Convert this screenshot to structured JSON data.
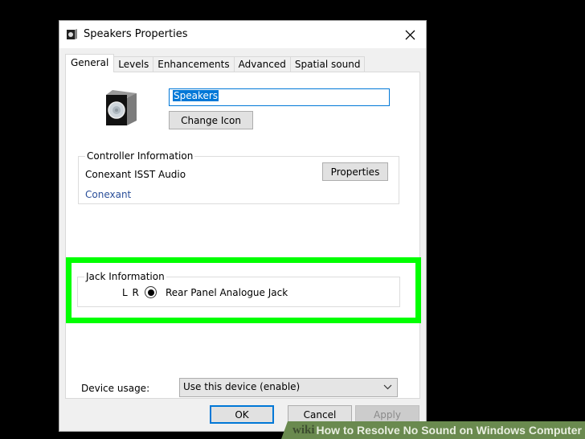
{
  "window": {
    "title": "Speakers Properties",
    "icon": "speaker-icon",
    "close_icon": "close-icon"
  },
  "tabs": [
    {
      "label": "General",
      "active": true
    },
    {
      "label": "Levels",
      "active": false
    },
    {
      "label": "Enhancements",
      "active": false
    },
    {
      "label": "Advanced",
      "active": false
    },
    {
      "label": "Spatial sound",
      "active": false
    }
  ],
  "general": {
    "device_name_value": "Speakers",
    "change_icon_label": "Change Icon",
    "controller": {
      "legend": "Controller Information",
      "name": "Conexant ISST Audio",
      "vendor_link": "Conexant",
      "properties_label": "Properties"
    },
    "jack": {
      "legend": "Jack Information",
      "channels": "L R",
      "selected": true,
      "label": "Rear Panel Analogue Jack"
    },
    "device_usage": {
      "label": "Device usage:",
      "value": "Use this device (enable)"
    }
  },
  "footer": {
    "ok_label": "OK",
    "cancel_label": "Cancel",
    "apply_label": "Apply"
  },
  "banner": {
    "brand": "wiki",
    "text": "How to Resolve No Sound on Windows Computer"
  },
  "colors": {
    "highlight": "#00ff00",
    "accent": "#0078d7",
    "link": "#2b4f9a"
  }
}
